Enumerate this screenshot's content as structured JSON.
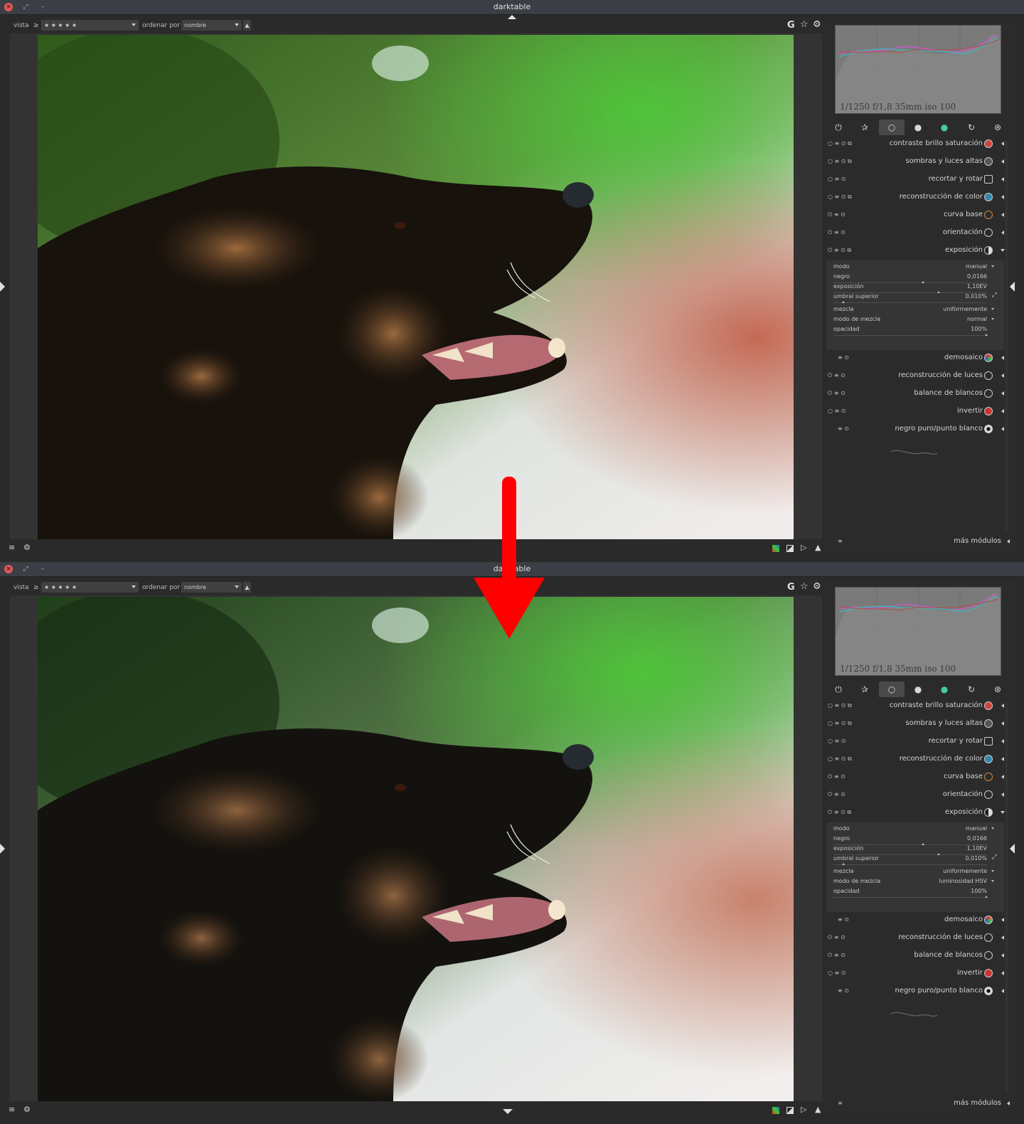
{
  "app_title": "darktable",
  "toolbar": {
    "view_label": "vista",
    "rating_op": "≥",
    "rating_value": "★ ★ ★ ★ ★",
    "sort_label": "ordenar por",
    "sort_value": "nombre",
    "sort_dir": "▲"
  },
  "top_right_icons": [
    "G",
    "☆",
    "⚙"
  ],
  "histogram_info": "1/1250 f/1,8 35mm iso 100",
  "group_tabs": [
    "power-icon",
    "star-icon",
    "circle-icon",
    "half-circle-icon",
    "color-circle-icon",
    "rotate-icon",
    "misc-icon"
  ],
  "bottom_left": {
    "menu": "≡",
    "settings": "⚙"
  },
  "more_modules_label": "más módulos",
  "windows": [
    {
      "modules": [
        {
          "name": "contraste brillo saturación",
          "color": "#c44"
        },
        {
          "name": "sombras y luces altas",
          "color": "#444"
        },
        {
          "name": "recortar y rotar",
          "color": "#333"
        },
        {
          "name": "reconstrucción de color",
          "color": "#38a"
        },
        {
          "name": "curva base",
          "color": "#a63"
        },
        {
          "name": "orientación",
          "color": "#333"
        },
        {
          "name": "exposición",
          "color": "#333"
        },
        {
          "name": "demosaico",
          "color": "#4a4"
        },
        {
          "name": "reconstrucción de luces",
          "color": "#333"
        },
        {
          "name": "balance de blancos",
          "color": "#333"
        },
        {
          "name": "invertir",
          "color": "#c33"
        },
        {
          "name": "negro puro/punto blanco",
          "color": "#111"
        }
      ],
      "exposure": {
        "mode_label": "modo",
        "mode_value": "manual",
        "black_label": "negro",
        "black_value": "0,0166",
        "exposure_label": "exposición",
        "exposure_value": "1,10EV",
        "threshold_label": "umbral superior",
        "threshold_value": "0,010%",
        "blend_label": "mezcla",
        "blend_value": "uniformemente",
        "blend_mode_label": "modo de mezcla",
        "blend_mode_value": "normal",
        "opacity_label": "opacidad",
        "opacity_value": "100%"
      }
    },
    {
      "modules": [
        {
          "name": "contraste brillo saturación",
          "color": "#c44"
        },
        {
          "name": "sombras y luces altas",
          "color": "#444"
        },
        {
          "name": "recortar y rotar",
          "color": "#333"
        },
        {
          "name": "reconstrucción de color",
          "color": "#38a"
        },
        {
          "name": "curva base",
          "color": "#a63"
        },
        {
          "name": "orientación",
          "color": "#333"
        },
        {
          "name": "exposición",
          "color": "#333"
        },
        {
          "name": "demosaico",
          "color": "#4a4"
        },
        {
          "name": "reconstrucción de luces",
          "color": "#333"
        },
        {
          "name": "balance de blancos",
          "color": "#333"
        },
        {
          "name": "invertir",
          "color": "#c33"
        },
        {
          "name": "negro puro/punto blanco",
          "color": "#111"
        }
      ],
      "exposure": {
        "mode_label": "modo",
        "mode_value": "manual",
        "black_label": "negro",
        "black_value": "0,0166",
        "exposure_label": "exposición",
        "exposure_value": "1,10EV",
        "threshold_label": "umbral superior",
        "threshold_value": "0,010%",
        "blend_label": "mezcla",
        "blend_value": "uniformemente",
        "blend_mode_label": "modo de mezcla",
        "blend_mode_value": "luminosidad HSV",
        "opacity_label": "opacidad",
        "opacity_value": "100%"
      }
    }
  ],
  "annotation_arrow_color": "#ff0000"
}
